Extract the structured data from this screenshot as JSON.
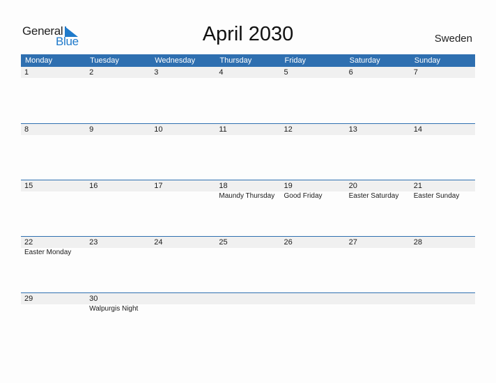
{
  "logo": {
    "word1": "General",
    "word2": "Blue",
    "accent_color": "#1f7acb"
  },
  "title": "April 2030",
  "country": "Sweden",
  "colors": {
    "header_bg": "#2e6fb0",
    "day_row_bg": "#f0f0f0"
  },
  "weekdays": [
    "Monday",
    "Tuesday",
    "Wednesday",
    "Thursday",
    "Friday",
    "Saturday",
    "Sunday"
  ],
  "weeks": [
    {
      "days": [
        {
          "num": "1",
          "event": ""
        },
        {
          "num": "2",
          "event": ""
        },
        {
          "num": "3",
          "event": ""
        },
        {
          "num": "4",
          "event": ""
        },
        {
          "num": "5",
          "event": ""
        },
        {
          "num": "6",
          "event": ""
        },
        {
          "num": "7",
          "event": ""
        }
      ]
    },
    {
      "days": [
        {
          "num": "8",
          "event": ""
        },
        {
          "num": "9",
          "event": ""
        },
        {
          "num": "10",
          "event": ""
        },
        {
          "num": "11",
          "event": ""
        },
        {
          "num": "12",
          "event": ""
        },
        {
          "num": "13",
          "event": ""
        },
        {
          "num": "14",
          "event": ""
        }
      ]
    },
    {
      "days": [
        {
          "num": "15",
          "event": ""
        },
        {
          "num": "16",
          "event": ""
        },
        {
          "num": "17",
          "event": ""
        },
        {
          "num": "18",
          "event": "Maundy Thursday"
        },
        {
          "num": "19",
          "event": "Good Friday"
        },
        {
          "num": "20",
          "event": "Easter Saturday"
        },
        {
          "num": "21",
          "event": "Easter Sunday"
        }
      ]
    },
    {
      "days": [
        {
          "num": "22",
          "event": "Easter Monday"
        },
        {
          "num": "23",
          "event": ""
        },
        {
          "num": "24",
          "event": ""
        },
        {
          "num": "25",
          "event": ""
        },
        {
          "num": "26",
          "event": ""
        },
        {
          "num": "27",
          "event": ""
        },
        {
          "num": "28",
          "event": ""
        }
      ]
    },
    {
      "days": [
        {
          "num": "29",
          "event": ""
        },
        {
          "num": "30",
          "event": "Walpurgis Night"
        },
        {
          "num": "",
          "event": ""
        },
        {
          "num": "",
          "event": ""
        },
        {
          "num": "",
          "event": ""
        },
        {
          "num": "",
          "event": ""
        },
        {
          "num": "",
          "event": ""
        }
      ]
    }
  ]
}
